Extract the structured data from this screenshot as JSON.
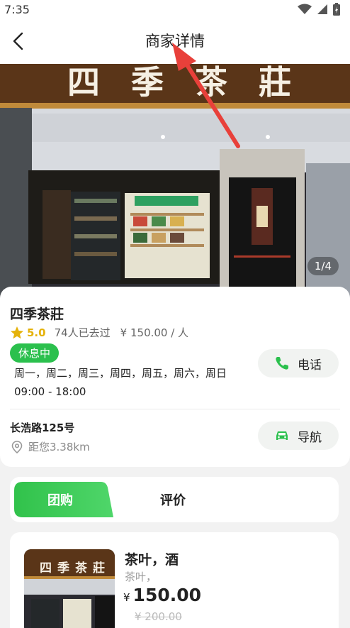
{
  "status_bar": {
    "time": "7:35"
  },
  "nav": {
    "title": "商家详情"
  },
  "hero": {
    "sign_text": "四季茶莊",
    "counter": "1/4"
  },
  "shop": {
    "name": "四季茶莊",
    "rating": "5.0",
    "visited": "74人已去过",
    "price": "¥ 150.00 / 人",
    "status": "休息中",
    "open_days": "周一，周二，周三，周四，周五，周六，周日",
    "open_hours": "09:00 - 18:00",
    "phone_label": "电话",
    "address": "长浩路125号",
    "distance": "距您3.38km",
    "nav_label": "导航"
  },
  "tabs": {
    "active": "团购",
    "inactive": "评价"
  },
  "deal": {
    "title": "茶叶，酒",
    "subtitle": "茶叶，",
    "currency": "¥",
    "price": "150.00",
    "original_price": "¥ 200.00",
    "image_sign": "四季茶莊"
  },
  "colors": {
    "accent_green": "#2bc04d",
    "rating_gold": "#e5b20a",
    "annotation_red": "#e8403a"
  }
}
